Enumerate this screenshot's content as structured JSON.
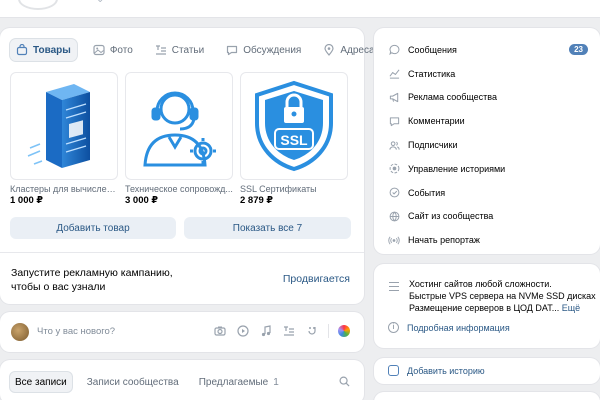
{
  "tabs": [
    {
      "label": "Товары",
      "icon": "bag-icon"
    },
    {
      "label": "Фото",
      "icon": "photo-icon"
    },
    {
      "label": "Статьи",
      "icon": "articles-icon"
    },
    {
      "label": "Обсуждения",
      "icon": "discussion-icon"
    },
    {
      "label": "Адреса",
      "icon": "location-icon"
    }
  ],
  "products": [
    {
      "name": "Кластеры для вычислен...",
      "price": "1 000 ₽",
      "image": "server-rack-icon"
    },
    {
      "name": "Техническое сопровожд...",
      "price": "3 000 ₽",
      "image": "support-operator-icon"
    },
    {
      "name": "SSL Сертификаты",
      "price": "2 879 ₽",
      "image": "ssl-shield-icon"
    }
  ],
  "buttons": {
    "add_product": "Добавить товар",
    "show_all": "Показать все 7"
  },
  "promo": {
    "text": "Запустите рекламную кампанию, чтобы о вас узнали",
    "action": "Продвигается"
  },
  "composer": {
    "placeholder": "Что у вас нового?"
  },
  "feed_tabs": [
    {
      "label": "Все записи",
      "active": true,
      "count": ""
    },
    {
      "label": "Записи сообщества",
      "active": false,
      "count": ""
    },
    {
      "label": "Предлагаемые",
      "active": false,
      "count": "1"
    }
  ],
  "menu": [
    {
      "label": "Сообщения",
      "icon": "message-icon",
      "badge": "23"
    },
    {
      "label": "Статистика",
      "icon": "stats-icon",
      "badge": ""
    },
    {
      "label": "Реклама сообщества",
      "icon": "megaphone-icon",
      "badge": ""
    },
    {
      "label": "Комментарии",
      "icon": "comment-icon",
      "badge": ""
    },
    {
      "label": "Подписчики",
      "icon": "users-icon",
      "badge": ""
    },
    {
      "label": "Управление историями",
      "icon": "stories-icon",
      "badge": ""
    },
    {
      "label": "События",
      "icon": "events-icon",
      "badge": ""
    },
    {
      "label": "Сайт из сообщества",
      "icon": "site-icon",
      "badge": ""
    },
    {
      "label": "Начать репортаж",
      "icon": "broadcast-icon",
      "badge": ""
    }
  ],
  "ad": {
    "line1": "Хостинг сайтов любой сложности.",
    "line2": "Быстрые VPS сервера на NVMe SSD дисках",
    "line3": "Размещение серверов в ЦОД DAT...",
    "more": "Ещё",
    "info": "Подробная информация"
  },
  "story": {
    "label": "Добавить историю"
  },
  "colors": {
    "accent": "#2a5885",
    "badge": "#5181b8",
    "bg": "#edeef0"
  }
}
